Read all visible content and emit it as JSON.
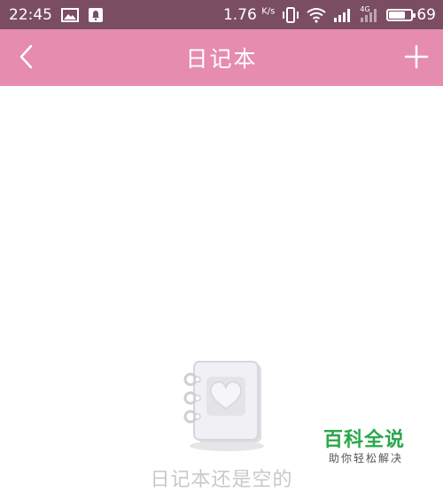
{
  "status_bar": {
    "time": "22:45",
    "network_speed": "1.76",
    "network_unit": "K/s",
    "network_type": "4G",
    "battery": "69",
    "icons": [
      "image-icon",
      "notification-icon",
      "vibrate-icon",
      "wifi-icon",
      "signal-icon",
      "signal-4g-icon",
      "battery-icon"
    ],
    "colors": {
      "background": "#7a4d63"
    }
  },
  "header": {
    "title": "日记本",
    "back_icon": "back-chevron-icon",
    "add_icon": "plus-icon",
    "colors": {
      "background": "#e58caf"
    }
  },
  "empty_state": {
    "icon": "notebook-heart-icon",
    "message": "日记本还是空的"
  },
  "watermark": {
    "title": "百科全说",
    "subtitle": "助你轻松解决"
  }
}
